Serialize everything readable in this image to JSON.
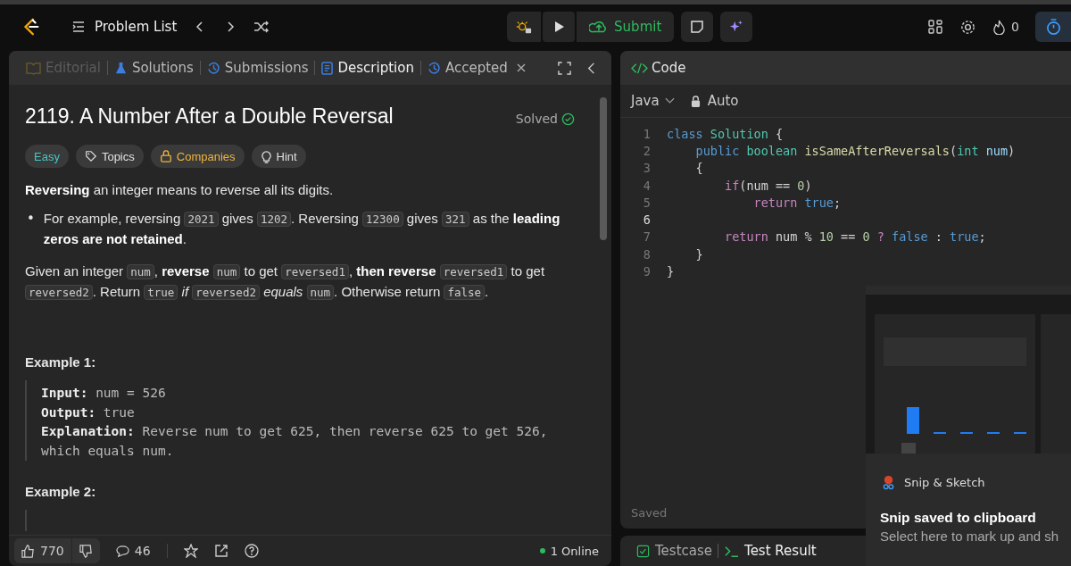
{
  "top_bar": {
    "problem_list": "Problem List",
    "submit": "Submit",
    "streak": "0"
  },
  "left_tabs": [
    {
      "label": "Editorial",
      "kind": "editorial",
      "selected": false,
      "disabled": true,
      "closable": false
    },
    {
      "label": "Solutions",
      "kind": "solutions",
      "selected": false,
      "disabled": false,
      "closable": false
    },
    {
      "label": "Submissions",
      "kind": "history",
      "selected": false,
      "disabled": false,
      "closable": false
    },
    {
      "label": "Description",
      "kind": "description",
      "selected": true,
      "disabled": false,
      "closable": false
    },
    {
      "label": "Accepted",
      "kind": "history",
      "selected": false,
      "disabled": false,
      "closable": true
    }
  ],
  "problem": {
    "title": "2119. A Number After a Double Reversal",
    "status": "Solved",
    "difficulty": "Easy",
    "tags": [
      {
        "label": "Topics",
        "kind": "topics"
      },
      {
        "label": "Companies",
        "kind": "companies"
      },
      {
        "label": "Hint",
        "kind": "hint"
      }
    ]
  },
  "description": [
    {
      "kind": "paragraph",
      "segments": [
        {
          "kind": "text",
          "text": "**Reversing** an integer means to reverse all its digits."
        }
      ]
    },
    {
      "kind": "bullet",
      "marker": "•",
      "segments": [
        {
          "kind": "text",
          "text": "For example, reversing "
        },
        {
          "kind": "code",
          "text": "2021"
        },
        {
          "kind": "text",
          "text": " gives "
        },
        {
          "kind": "code",
          "text": "1202"
        },
        {
          "kind": "text",
          "text": ". Reversing "
        },
        {
          "kind": "code",
          "text": "12300"
        },
        {
          "kind": "text",
          "text": " gives "
        },
        {
          "kind": "code",
          "text": "321"
        },
        {
          "kind": "text",
          "text": " as the **leading zeros are not retained**."
        }
      ]
    },
    {
      "kind": "paragraph",
      "segments": [
        {
          "kind": "text",
          "text": "Given an integer "
        },
        {
          "kind": "code",
          "text": "num"
        },
        {
          "kind": "text",
          "text": ", **reverse** "
        },
        {
          "kind": "code",
          "text": "num"
        },
        {
          "kind": "text",
          "text": " to get "
        },
        {
          "kind": "code",
          "text": "reversed1"
        },
        {
          "kind": "text",
          "text": ", **then reverse** "
        },
        {
          "kind": "code",
          "text": "reversed1"
        },
        {
          "kind": "text",
          "text": " to get "
        },
        {
          "kind": "code",
          "text": "reversed2"
        },
        {
          "kind": "text",
          "text": ". Return "
        },
        {
          "kind": "code",
          "text": "true"
        },
        {
          "kind": "text",
          "text": " *if* "
        },
        {
          "kind": "code",
          "text": "reversed2"
        },
        {
          "kind": "text",
          "text": " *equals* "
        },
        {
          "kind": "code",
          "text": "num"
        },
        {
          "kind": "text",
          "text": ". Otherwise return "
        },
        {
          "kind": "code",
          "text": "false"
        },
        {
          "kind": "text",
          "text": "."
        }
      ]
    }
  ],
  "examples": [
    {
      "heading": "Example 1:",
      "lines": [
        {
          "label": "Input:",
          "value": "num = 526"
        },
        {
          "label": "Output:",
          "value": "true"
        },
        {
          "label": "Explanation:",
          "value": "Reverse num to get 625, then reverse 625 to get 526, which equals num."
        }
      ]
    },
    {
      "heading": "Example 2:"
    }
  ],
  "footer": {
    "likes": "770",
    "comments": "46",
    "online": "1 Online"
  },
  "code_panel": {
    "title": "Code",
    "language": "Java",
    "mode": "Auto",
    "saved": "Saved",
    "lines": [
      {
        "number": "1",
        "active": false,
        "tokens": [
          {
            "kind": "keyword",
            "text": "class"
          },
          {
            "kind": "type",
            "text": " Solution"
          },
          {
            "kind": "plain",
            "text": " {"
          }
        ]
      },
      {
        "number": "2",
        "active": false,
        "tokens": [
          {
            "kind": "keyword",
            "text": "    public"
          },
          {
            "kind": "type",
            "text": " boolean"
          },
          {
            "kind": "function",
            "text": " isSameAfterReversals"
          },
          {
            "kind": "plain",
            "text": "("
          },
          {
            "kind": "type",
            "text": "int"
          },
          {
            "kind": "param",
            "text": " num"
          },
          {
            "kind": "plain",
            "text": ")"
          }
        ]
      },
      {
        "number": "3",
        "active": false,
        "tokens": [
          {
            "kind": "plain",
            "text": "    {"
          }
        ]
      },
      {
        "number": "4",
        "active": false,
        "tokens": [
          {
            "kind": "control",
            "text": "        if"
          },
          {
            "kind": "plain",
            "text": "(num == "
          },
          {
            "kind": "number",
            "text": "0"
          },
          {
            "kind": "plain",
            "text": ")"
          }
        ]
      },
      {
        "number": "5",
        "active": false,
        "tokens": [
          {
            "kind": "control",
            "text": "            return"
          },
          {
            "kind": "literal",
            "text": " true"
          },
          {
            "kind": "plain",
            "text": ";"
          }
        ]
      },
      {
        "number": "6",
        "active": true
      },
      {
        "number": "7",
        "active": false,
        "tokens": [
          {
            "kind": "control",
            "text": "        return"
          },
          {
            "kind": "plain",
            "text": " num % "
          },
          {
            "kind": "number",
            "text": "10"
          },
          {
            "kind": "plain",
            "text": " == "
          },
          {
            "kind": "number",
            "text": "0"
          },
          {
            "kind": "control",
            "text": " ?"
          },
          {
            "kind": "literal",
            "text": " false"
          },
          {
            "kind": "plain",
            "text": " : "
          },
          {
            "kind": "literal",
            "text": "true"
          },
          {
            "kind": "plain",
            "text": ";"
          }
        ]
      },
      {
        "number": "8",
        "active": false,
        "tokens": [
          {
            "kind": "plain",
            "text": "    }"
          }
        ]
      },
      {
        "number": "9",
        "active": false,
        "tokens": [
          {
            "kind": "plain",
            "text": "}"
          }
        ]
      }
    ]
  },
  "bottom_tabs": [
    {
      "label": "Testcase",
      "kind": "testcase",
      "selected": false
    },
    {
      "label": "Test Result",
      "kind": "result",
      "selected": true
    }
  ],
  "notification": {
    "app": "Snip & Sketch",
    "title": "Snip saved to clipboard",
    "body": "Select here to mark up and sh"
  }
}
